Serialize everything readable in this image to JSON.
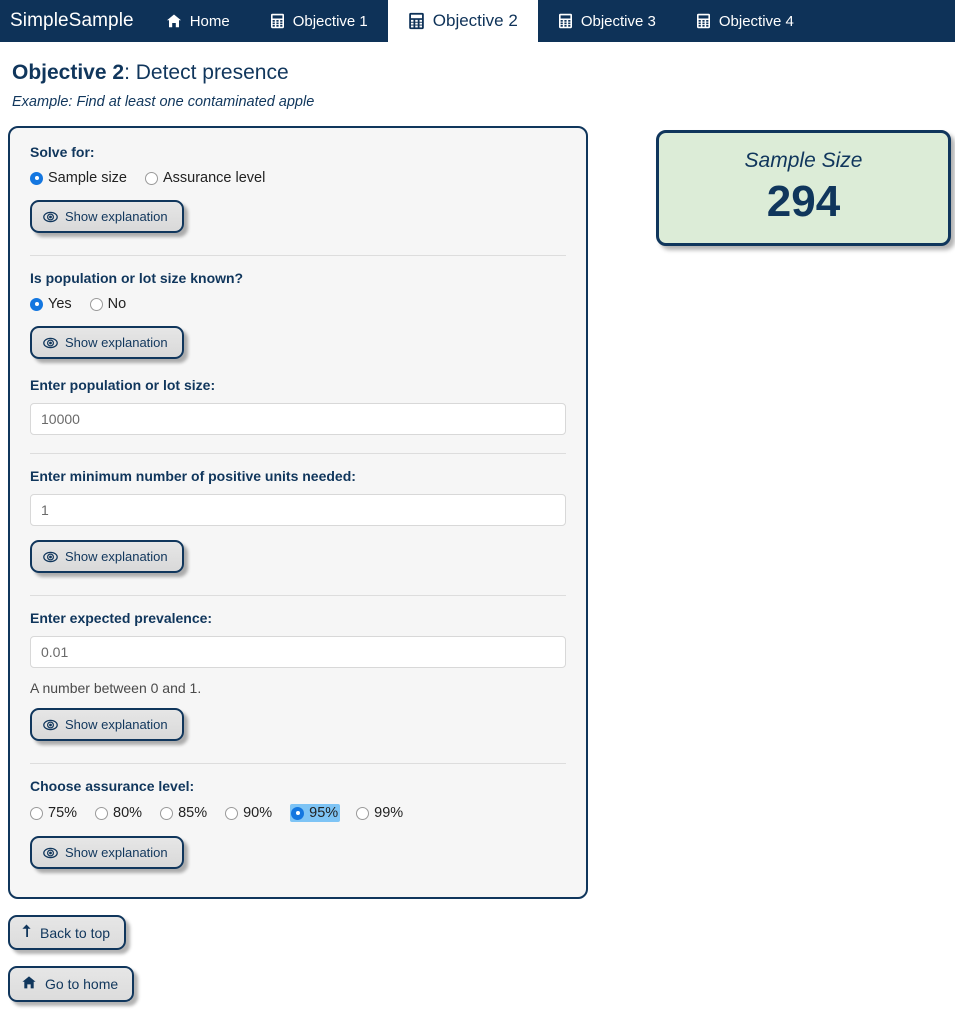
{
  "navbar": {
    "brand": "SimpleSample",
    "background_color": "#0e3258",
    "active_tab_index": 2,
    "tabs": [
      {
        "label": "Home",
        "icon": "home-icon"
      },
      {
        "label": "Objective 1",
        "icon": "calculator-icon"
      },
      {
        "label": "Objective 2",
        "icon": "calculator-icon"
      },
      {
        "label": "Objective 3",
        "icon": "calculator-icon"
      },
      {
        "label": "Objective 4",
        "icon": "calculator-icon"
      }
    ]
  },
  "header": {
    "title_bold": "Objective 2",
    "title_rest": ": Detect presence",
    "subtitle": "Example: Find at least one contaminated apple",
    "title_color": "#10365c"
  },
  "form": {
    "explain_button_label": "Show explanation",
    "sections": {
      "solve_for": {
        "label": "Solve for:",
        "options": [
          {
            "label": "Sample size",
            "selected": true
          },
          {
            "label": "Assurance level",
            "selected": false
          }
        ]
      },
      "population_known": {
        "label": "Is population or lot size known?",
        "options": [
          {
            "label": "Yes",
            "selected": true
          },
          {
            "label": "No",
            "selected": false
          }
        ]
      },
      "population_size": {
        "label": "Enter population or lot size:",
        "value": "10000",
        "placeholder": "10000"
      },
      "positive_units": {
        "label": "Enter minimum number of positive units needed:",
        "value": "1",
        "placeholder": "1"
      },
      "prevalence": {
        "label": "Enter expected prevalence:",
        "value": "0.01",
        "placeholder": "0.01",
        "help_text": "A number between 0 and 1."
      },
      "assurance_level": {
        "label": "Choose assurance level:",
        "options": [
          {
            "label": "75%",
            "selected": false,
            "focused": false
          },
          {
            "label": "80%",
            "selected": false,
            "focused": false
          },
          {
            "label": "85%",
            "selected": false,
            "focused": false
          },
          {
            "label": "90%",
            "selected": false,
            "focused": false
          },
          {
            "label": "95%",
            "selected": true,
            "focused": true
          },
          {
            "label": "99%",
            "selected": false,
            "focused": false
          }
        ]
      }
    }
  },
  "result": {
    "label": "Sample Size",
    "value": "294",
    "background_color": "#dcecd7",
    "border_color": "#10365c"
  },
  "footer": {
    "back_to_top_label": "Back to top",
    "back_to_top_icon": "arrow-up-icon",
    "go_to_home_label": "Go to home",
    "go_to_home_icon": "home-icon"
  }
}
